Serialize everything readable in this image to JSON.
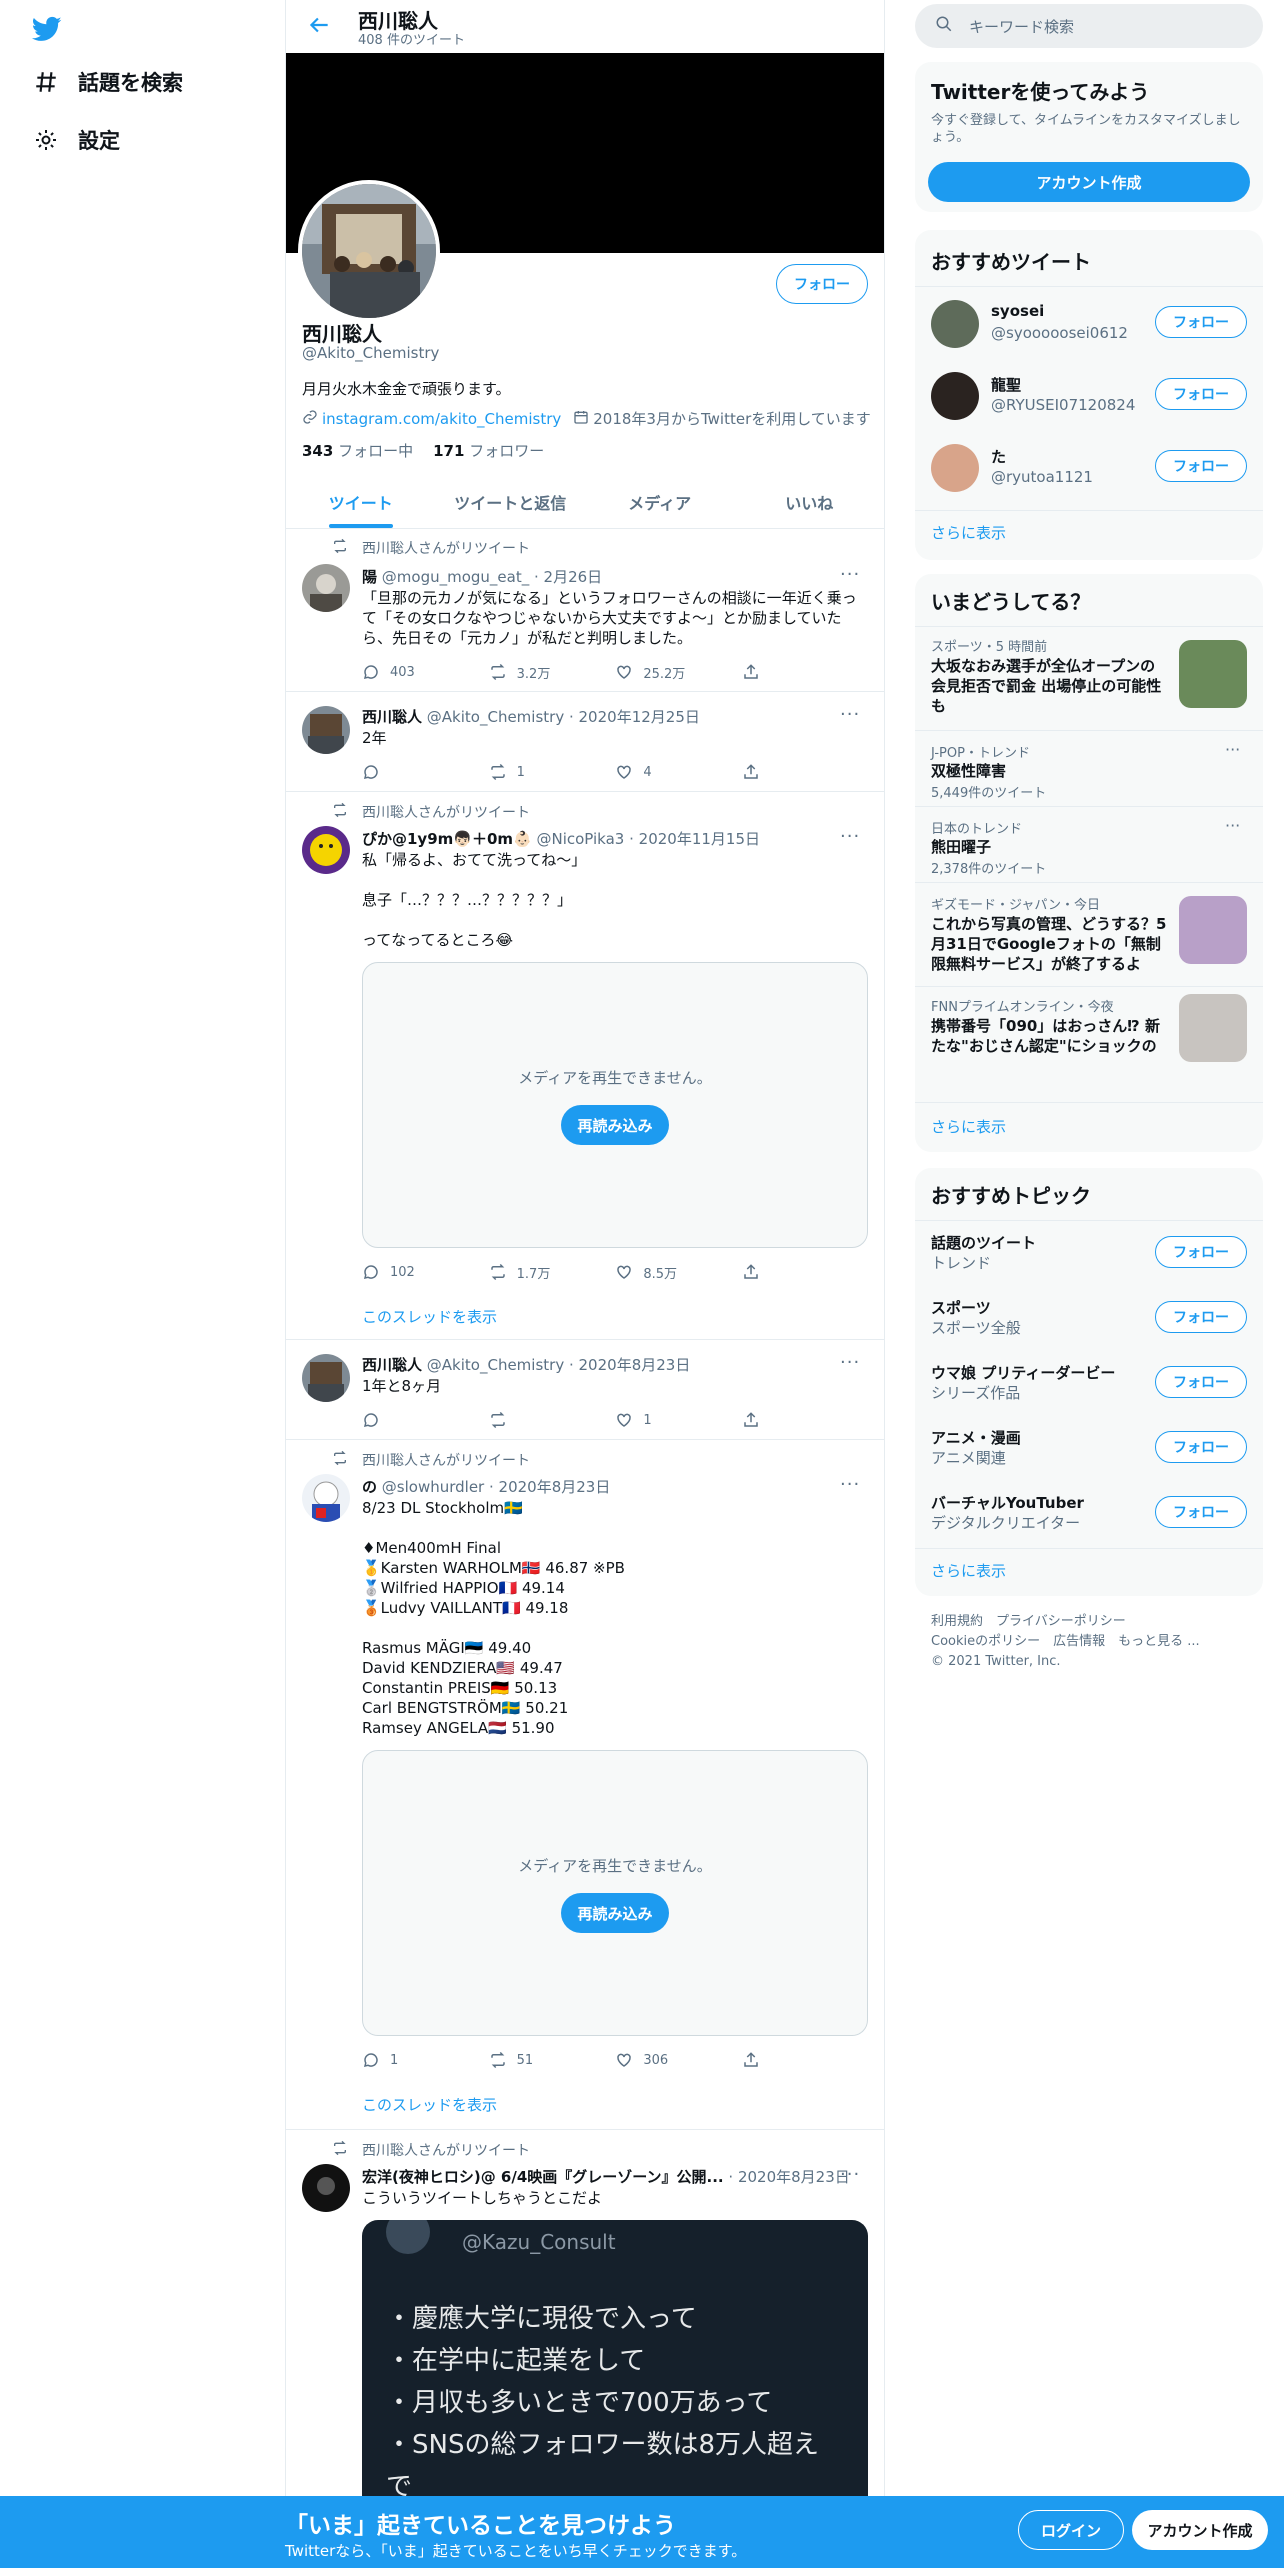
{
  "nav": {
    "explore_label": "話題を検索",
    "settings_label": "設定"
  },
  "header": {
    "name": "西川聡人",
    "tweet_count": "408 件のツイート"
  },
  "profile": {
    "name": "西川聡人",
    "handle": "@Akito_Chemistry",
    "bio": "月月火水木金金で頑張ります。",
    "link": "instagram.com/akito_Chemistry",
    "joined": "2018年3月からTwitterを利用しています",
    "following_count": "343",
    "following_label": "フォロー中",
    "followers_count": "171",
    "followers_label": "フォロワー",
    "follow_label": "フォロー"
  },
  "tabs": [
    "ツイート",
    "ツイートと返信",
    "メディア",
    "いいね"
  ],
  "tweets": [
    {
      "retweet_by": "西川聡人さんがリツイート",
      "name": "陽",
      "handle": "@mogu_mogu_eat_",
      "date": "2月26日",
      "text": "「旦那の元カノが気になる」というフォロワーさんの相談に一年近く乗って「その女ロクなやつじゃないから大丈夫ですよ〜」とか励ましていたら、先日その「元カノ」が私だと判明しました。",
      "replies": "403",
      "retweets": "3.2万",
      "likes": "25.2万"
    },
    {
      "name": "西川聡人",
      "handle": "@Akito_Chemistry",
      "date": "2020年12月25日",
      "text": "2年",
      "replies": "",
      "retweets": "1",
      "likes": "4"
    },
    {
      "retweet_by": "西川聡人さんがリツイート",
      "name": "ぴか@1y9m👦🏻＋0m👶🏻",
      "handle": "@NicoPika3",
      "date": "2020年11月15日",
      "text": "私「帰るよ、おてて洗ってね〜」\n\n息子「…？？？…？？？？？」\n\nってなってるところ😂",
      "media_msg": "メディアを再生できません。",
      "reload": "再読み込み",
      "replies": "102",
      "retweets": "1.7万",
      "likes": "8.5万",
      "thread": "このスレッドを表示"
    },
    {
      "name": "西川聡人",
      "handle": "@Akito_Chemistry",
      "date": "2020年8月23日",
      "text": "1年と8ヶ月",
      "replies": "",
      "retweets": "",
      "likes": "1"
    },
    {
      "retweet_by": "西川聡人さんがリツイート",
      "name": "の",
      "handle": "@slowhurdler",
      "date": "2020年8月23日",
      "text": "8/23 DL Stockholm🇸🇪\n\n♦Men400mH Final\n🥇Karsten WARHOLM🇳🇴 46.87 ※PB\n🥈Wilfried HAPPIO🇫🇷 49.14\n🥉Ludvy VAILLANT🇫🇷 49.18\n\nRasmus MÄGI🇪🇪 49.40\nDavid KENDZIERA🇺🇸 49.47\nConstantin PREIS🇩🇪 50.13\nCarl BENGTSTRÖM🇸🇪 50.21\nRamsey ANGELA🇳🇱 51.90",
      "media_msg": "メディアを再生できません。",
      "reload": "再読み込み",
      "replies": "1",
      "retweets": "51",
      "likes": "306",
      "thread": "このスレッドを表示"
    },
    {
      "retweet_by": "西川聡人さんがリツイート",
      "name": "宏洋(夜神ヒロシ)@ 6/4映画『グレーゾーン』公開...",
      "date": "2020年8月23日",
      "text": "こういうツイートしちゃうとこだよ",
      "quote_handle": "@Kazu_Consult",
      "quote_lines": [
        "・慶應大学に現役で入って",
        "・在学中に起業をして",
        "・月収も多いときで700万あって",
        "・SNSの総フォロワー数は8万人超え",
        "で"
      ]
    }
  ],
  "right": {
    "search_placeholder": "キーワード検索",
    "join": {
      "title": "Twitterを使ってみよう",
      "desc": "今すぐ登録して、タイムラインをカスタマイズしましょう。",
      "button": "アカウント作成"
    },
    "who_to_follow": {
      "title": "おすすめツイート",
      "users": [
        {
          "name": "syosei",
          "handle": "@syooooosei0612"
        },
        {
          "name": "龍聖",
          "handle": "@RYUSEI07120824"
        },
        {
          "name": "た",
          "handle": "@ryutoa1121"
        }
      ],
      "more": "さらに表示",
      "follow": "フォロー"
    },
    "trends": {
      "title": "いまどうしてる？",
      "items": [
        {
          "meta": "スポーツ・5 時間前",
          "title": "大坂なおみ選手が全仏オープンの会見拒否で罰金 出場停止の可能性も"
        },
        {
          "meta": "J-POP・トレンド",
          "title": "双極性障害",
          "count": "5,449件のツイート"
        },
        {
          "meta": "日本のトレンド",
          "title": "熊田曜子",
          "count": "2,378件のツイート"
        },
        {
          "meta": "ギズモード・ジャパン・今日",
          "title": "これから写真の管理、どうする？5月31日でGoogleフォトの「無制限無料サービス」が終了するよ"
        },
        {
          "meta": "FNNプライムオンライン・今夜",
          "title": "携帯番号「090」はおっさん⁉ 新たな\"おじさん認定\"にショックの声..."
        }
      ],
      "more": "さらに表示"
    },
    "topics": {
      "title": "おすすめトピック",
      "items": [
        {
          "name": "話題のツイート",
          "sub": "トレンド"
        },
        {
          "name": "スポーツ",
          "sub": "スポーツ全般"
        },
        {
          "name": "ウマ娘 プリティーダービー",
          "sub": "シリーズ作品"
        },
        {
          "name": "アニメ・漫画",
          "sub": "アニメ関連"
        },
        {
          "name": "バーチャルYouTuber",
          "sub": "デジタルクリエイター"
        }
      ],
      "more": "さらに表示",
      "follow": "フォロー"
    },
    "footer": {
      "line1": "利用規約　プライバシーポリシー",
      "line2": "Cookieのポリシー　広告情報　もっと見る ...",
      "line3": "© 2021 Twitter, Inc."
    }
  },
  "bottombar": {
    "title": "「いま」起きていることを見つけよう",
    "sub": "Twitterなら、「いま」起きていることをいち早くチェックできます。",
    "login": "ログイン",
    "signup": "アカウント作成"
  },
  "colors": {
    "accent": "#1d9bf0",
    "text": "#0f1419",
    "muted": "#5b7083"
  }
}
